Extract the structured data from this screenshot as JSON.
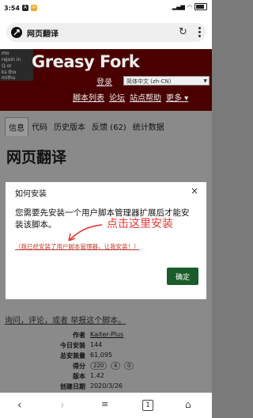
{
  "status": {
    "time": "3:54",
    "battery": "74"
  },
  "browser": {
    "url_title": "网页翻译"
  },
  "site": {
    "logo_lines": [
      "mo",
      "rejoin in",
      "Q or",
      "ks tho",
      "mithu"
    ],
    "name": "Greasy Fork",
    "login": "登录",
    "language": "简体中文 (zh-CN)",
    "nav": [
      "脚本列表",
      "论坛",
      "站点帮助",
      "更多"
    ]
  },
  "tabs": [
    "信息",
    "代码",
    "历史版本",
    "反馈 (62)",
    "统计数据"
  ],
  "page_title": "网页翻译",
  "modal": {
    "title": "如何安装",
    "close": "×",
    "body": "您需要先安装一个用户脚本管理器扩展后才能安装该脚本。",
    "link": "（我已经安装了用户脚本管理器，让我安装！）",
    "annotation": "点击这里安装",
    "confirm": "确定"
  },
  "below": {
    "prefix": "询问，评论，或者 ",
    "report": "举报这个脚本。"
  },
  "info": [
    {
      "k": "作者",
      "v": "Kaiter-Plus"
    },
    {
      "k": "今日安装",
      "v": "144"
    },
    {
      "k": "总安装量",
      "v": "61,095"
    },
    {
      "k": "得分",
      "v": ""
    },
    {
      "k": "版本",
      "v": "1.42"
    },
    {
      "k": "创建日期",
      "v": "2020/3/26"
    }
  ],
  "scores": [
    "220",
    "4",
    "0"
  ],
  "bottom": {
    "tabs_count": "1"
  }
}
